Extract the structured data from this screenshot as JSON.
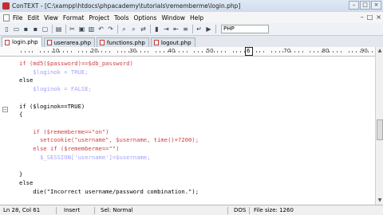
{
  "window": {
    "title": "ConTEXT - [C:\\xampp\\htdocs\\phpacademy\\tutorials\\rememberme\\login.php]",
    "controls": [
      "–",
      "□",
      "×"
    ]
  },
  "menubar": {
    "items": [
      "File",
      "Edit",
      "View",
      "Format",
      "Project",
      "Tools",
      "Options",
      "Window",
      "Help"
    ],
    "right_controls": [
      "–",
      "□",
      "×"
    ]
  },
  "toolbar": {
    "language": "PHP"
  },
  "tabs": [
    {
      "label": "login.php",
      "active": true
    },
    {
      "label": "userarea.php",
      "active": false
    },
    {
      "label": "functions.php",
      "active": false
    },
    {
      "label": "logout.php",
      "active": false
    }
  ],
  "ruler": {
    "labels": [
      "10",
      "20",
      "30",
      "40",
      "50",
      "60",
      "70",
      "80",
      "90"
    ],
    "cursor_label": "6"
  },
  "code": {
    "lines": [
      [
        {
          "t": "if (md5($password)==$db_password)",
          "c": "str"
        }
      ],
      [
        {
          "t": "    $loginok = TRUE;",
          "c": "var"
        }
      ],
      [
        {
          "t": "else",
          "c": "kw"
        }
      ],
      [
        {
          "t": "    $loginok = FALSE;",
          "c": "var"
        }
      ],
      [
        {
          "t": "",
          "c": "kw"
        }
      ],
      [
        {
          "t": "if ($loginok==TRUE)",
          "c": "kw"
        }
      ],
      [
        {
          "t": "{",
          "c": "kw"
        }
      ],
      [
        {
          "t": "",
          "c": "kw"
        }
      ],
      [
        {
          "t": "    if ($rememberme==\"on\")",
          "c": "str"
        }
      ],
      [
        {
          "t": "      setcookie(\"username\", $username, time()+7200);",
          "c": "str"
        }
      ],
      [
        {
          "t": "    else if ($rememberme==\"\")",
          "c": "str"
        }
      ],
      [
        {
          "t": "      $_SESSION['username']=$username;",
          "c": "var"
        }
      ],
      [
        {
          "t": "",
          "c": "kw"
        }
      ],
      [
        {
          "t": "}",
          "c": "kw"
        }
      ],
      [
        {
          "t": "else",
          "c": "kw"
        }
      ],
      [
        {
          "t": "    die(\"Incorrect username/password combination.\");",
          "c": "kw"
        }
      ],
      [
        {
          "t": "",
          "c": "kw"
        }
      ]
    ]
  },
  "status": {
    "position": "Ln 28, Col 61",
    "mode": "Insert",
    "selection": "Sel: Normal",
    "line_ending": "DOS",
    "file_size": "File size: 1260"
  }
}
